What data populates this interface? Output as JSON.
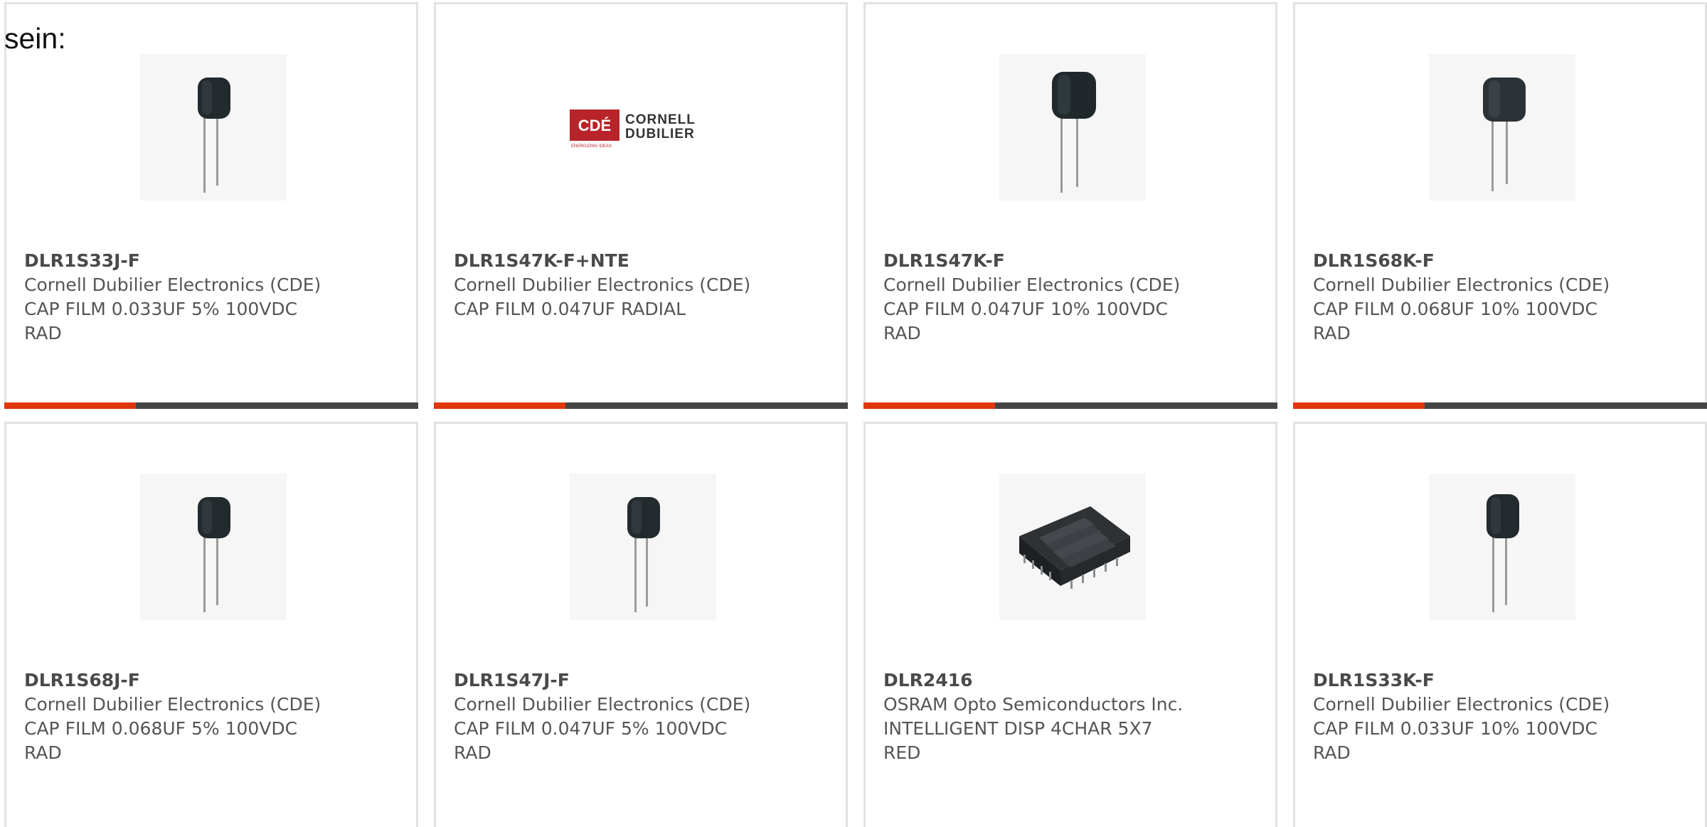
{
  "heading": "sein:",
  "products": [
    {
      "part_number": "DLR1S33J-F",
      "manufacturer": "Cornell Dubilier Electronics (CDE)",
      "description": "CAP FILM 0.033UF 5% 100VDC RAD",
      "image": "film-capacitor-icon"
    },
    {
      "part_number": "DLR1S47K-F+NTE",
      "manufacturer": "Cornell Dubilier Electronics (CDE)",
      "description": "CAP FILM 0.047UF RADIAL",
      "image": "cornell-dubilier-logo",
      "logo": {
        "badge": "CDÉ",
        "line1": "CORNELL",
        "line2": "DUBILIER",
        "tagline": "ENERGIZING IDEAS",
        "badge_color": "#b8242a"
      }
    },
    {
      "part_number": "DLR1S47K-F",
      "manufacturer": "Cornell Dubilier Electronics (CDE)",
      "description": "CAP FILM 0.047UF 10% 100VDC RAD",
      "image": "film-capacitor-icon"
    },
    {
      "part_number": "DLR1S68K-F",
      "manufacturer": "Cornell Dubilier Electronics (CDE)",
      "description": "CAP FILM 0.068UF 10% 100VDC RAD",
      "image": "film-capacitor-icon"
    },
    {
      "part_number": "DLR1S68J-F",
      "manufacturer": "Cornell Dubilier Electronics (CDE)",
      "description": "CAP FILM 0.068UF 5% 100VDC RAD",
      "image": "film-capacitor-icon"
    },
    {
      "part_number": "DLR1S47J-F",
      "manufacturer": "Cornell Dubilier Electronics (CDE)",
      "description": "CAP FILM 0.047UF 5% 100VDC RAD",
      "image": "film-capacitor-icon"
    },
    {
      "part_number": "DLR2416",
      "manufacturer": "OSRAM Opto Semiconductors Inc.",
      "description": "INTELLIGENT DISP 4CHAR 5X7 RED",
      "image": "led-display-module-icon"
    },
    {
      "part_number": "DLR1S33K-F",
      "manufacturer": "Cornell Dubilier Electronics (CDE)",
      "description": "CAP FILM 0.033UF 10% 100VDC RAD",
      "image": "film-capacitor-icon"
    }
  ],
  "colors": {
    "accent": "#e0360c",
    "bar": "#444444",
    "card_border": "#e2e2e2"
  }
}
